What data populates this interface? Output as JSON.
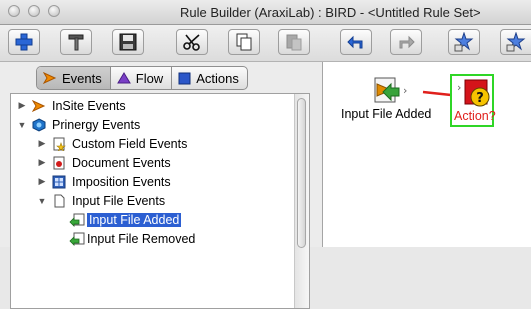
{
  "window": {
    "title": "Rule Builder (AraxiLab) : BIRD - <Untitled Rule Set>"
  },
  "toolbar": {
    "buttons": [
      {
        "name": "add",
        "icon": "plus-icon"
      },
      {
        "name": "tools",
        "icon": "hammer-icon"
      },
      {
        "name": "save",
        "icon": "floppy-disk-icon"
      },
      {
        "name": "cut",
        "icon": "scissors-icon"
      },
      {
        "name": "copy",
        "icon": "copy-icon"
      },
      {
        "name": "paste",
        "icon": "paste-icon",
        "enabled": false
      },
      {
        "name": "undo",
        "icon": "undo-arrow-icon"
      },
      {
        "name": "redo",
        "icon": "redo-arrow-icon",
        "enabled": false
      },
      {
        "name": "star-action",
        "icon": "star-node-icon"
      },
      {
        "name": "star-action-2",
        "icon": "star-node-icon"
      }
    ]
  },
  "tabs": {
    "items": [
      {
        "label": "Events",
        "icon": "orange-chevron-icon",
        "active": true
      },
      {
        "label": "Flow",
        "icon": "purple-triangle-icon",
        "active": false
      },
      {
        "label": "Actions",
        "icon": "blue-square-icon",
        "active": false
      }
    ]
  },
  "tree": {
    "items": [
      {
        "label": "InSite Events",
        "level": 0,
        "expanded": false,
        "icon": "orange-chevron-icon"
      },
      {
        "label": "Prinergy Events",
        "level": 0,
        "expanded": true,
        "icon": "prinergy-cube-icon"
      },
      {
        "label": "Custom Field Events",
        "level": 1,
        "expanded": false,
        "icon": "doc-star-icon"
      },
      {
        "label": "Document Events",
        "level": 1,
        "expanded": false,
        "icon": "doc-red-icon"
      },
      {
        "label": "Imposition Events",
        "level": 1,
        "expanded": false,
        "icon": "grid-icon"
      },
      {
        "label": "Input File Events",
        "level": 1,
        "expanded": true,
        "icon": "blank-doc-icon"
      },
      {
        "label": "Input File Added",
        "level": 2,
        "selected": true,
        "icon": "file-add-icon"
      },
      {
        "label": "Input File Removed",
        "level": 2,
        "selected": false,
        "icon": "file-remove-icon"
      }
    ]
  },
  "canvas": {
    "event_node": {
      "label": "Input File Added",
      "icon": "input-file-event-icon"
    },
    "action_node": {
      "label": "Action?",
      "icon": "action-question-icon"
    },
    "colors": {
      "connector": "#e0201c",
      "action_label": "#e0201c",
      "action_border": "#2fd626",
      "selection": "#2c5fd2"
    }
  }
}
